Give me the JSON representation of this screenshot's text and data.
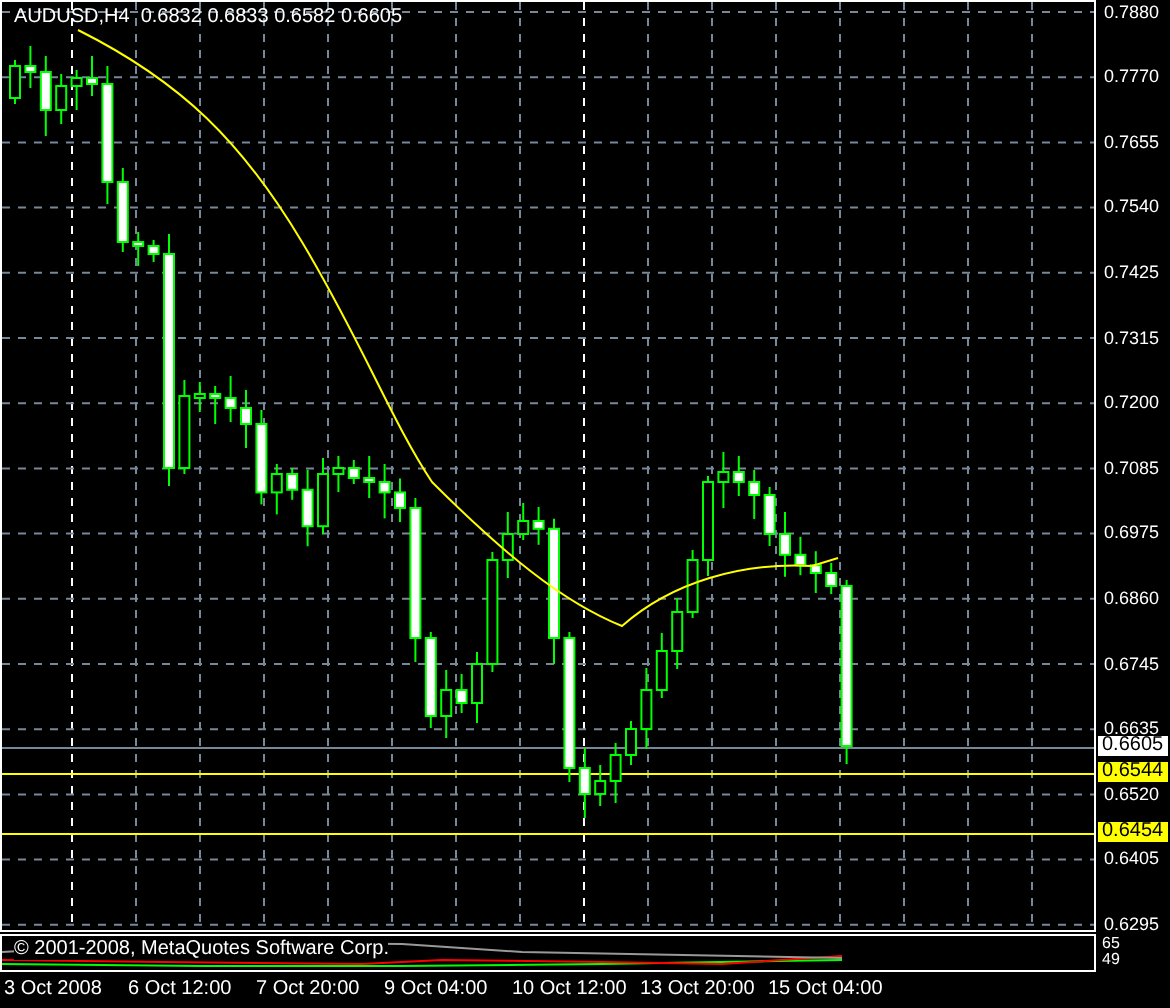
{
  "chart": {
    "header": "AUDUSD,H4  0.6832 0.6833 0.6582 0.6605",
    "price_axis": [
      "0.7880",
      "0.7770",
      "0.7655",
      "0.7540",
      "0.7425",
      "0.7315",
      "0.7200",
      "0.7085",
      "0.6975",
      "0.6860",
      "0.6745",
      "0.6635",
      "0.6520",
      "0.6405",
      "0.6295"
    ],
    "price_badges": [
      {
        "label": "0.6605",
        "color": "#ffffff"
      },
      {
        "label": "0.6544",
        "color": "#ffff00"
      },
      {
        "label": "0.6454",
        "color": "#ffff00"
      }
    ],
    "time_axis": [
      "3 Oct 2008",
      "6 Oct 12:00",
      "7 Oct 20:00",
      "9 Oct 04:00",
      "10 Oct 12:00",
      "13 Oct 20:00",
      "15 Oct 04:00"
    ]
  },
  "indicator": {
    "label": "© 2001-2008, MetaQuotes Software Corp.",
    "scale": [
      "65",
      "49"
    ]
  }
}
